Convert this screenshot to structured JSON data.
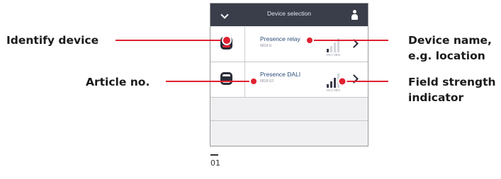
{
  "header": {
    "title": "Device selection"
  },
  "devices": [
    {
      "name": "Presence relay",
      "article": "6818-U",
      "signal_bars": 1,
      "signal_db": "-85,0 dBm",
      "identify_active": true
    },
    {
      "name": "Presence DALI",
      "article": "6818-U2",
      "signal_bars": 3,
      "signal_db": "-66,0 dBm",
      "identify_active": false
    }
  ],
  "callouts": {
    "identify_device": "Identify device",
    "article_no": "Article no.",
    "device_name_line1": "Device name,",
    "device_name_line2": "e.g. location",
    "field_strength_line1": "Field strength",
    "field_strength_line2": "indicator"
  },
  "figure": {
    "number": "01"
  },
  "colors": {
    "callout_red": "#e02030",
    "header_bg": "#3a3d4a",
    "name_blue": "#2a4c78"
  }
}
